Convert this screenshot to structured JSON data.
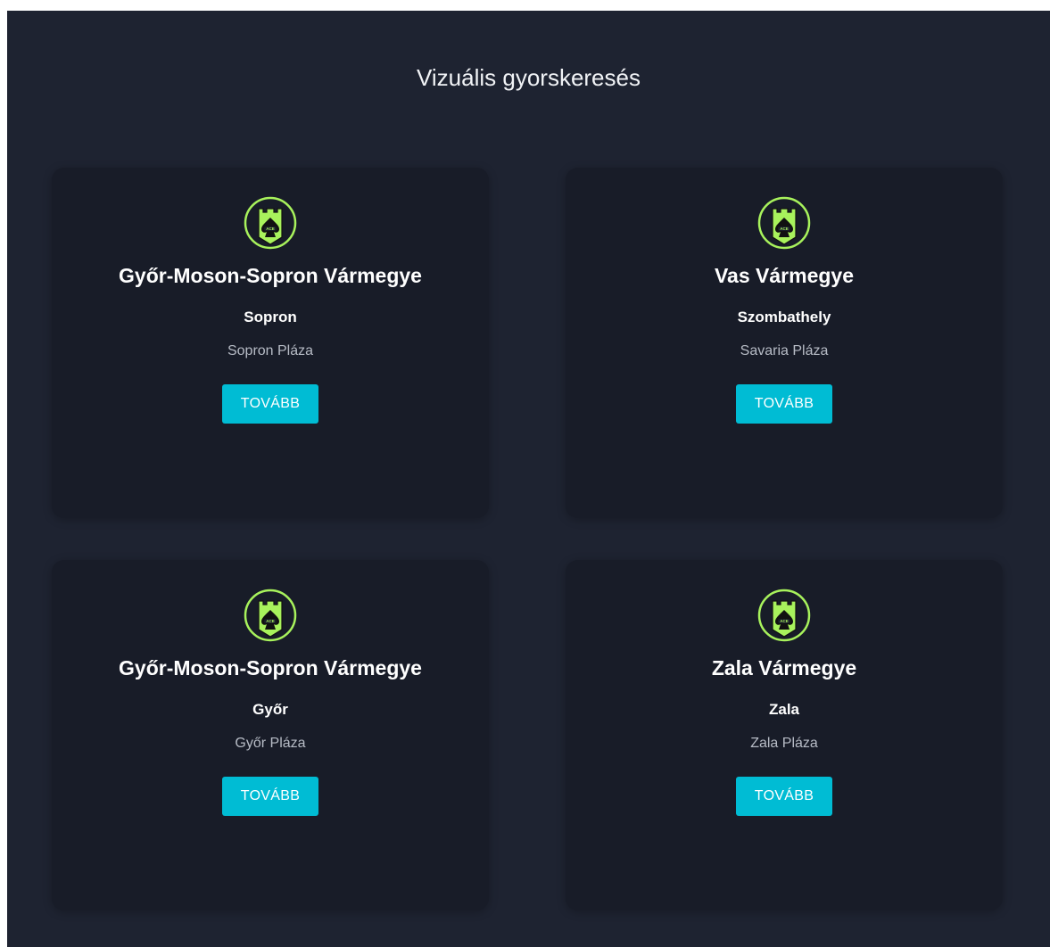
{
  "header": {
    "title": "Vizuális gyorskeresés"
  },
  "colors": {
    "background": "#1e2331",
    "card": "#181c28",
    "button": "#00bcd4",
    "logo_green": "#a8f25c"
  },
  "logo": {
    "icon": "castle-ace-of-spades-logo-icon",
    "text": "ACE"
  },
  "cards": [
    {
      "county": "Győr-Moson-Sopron Vármegye",
      "city": "Sopron",
      "venue": "Sopron Pláza",
      "button_label": "TOVÁBB"
    },
    {
      "county": "Vas Vármegye",
      "city": "Szombathely",
      "venue": "Savaria Pláza",
      "button_label": "TOVÁBB"
    },
    {
      "county": "Győr-Moson-Sopron Vármegye",
      "city": "Győr",
      "venue": "Győr Pláza",
      "button_label": "TOVÁBB"
    },
    {
      "county": "Zala Vármegye",
      "city": "Zala",
      "venue": "Zala Pláza",
      "button_label": "TOVÁBB"
    }
  ]
}
